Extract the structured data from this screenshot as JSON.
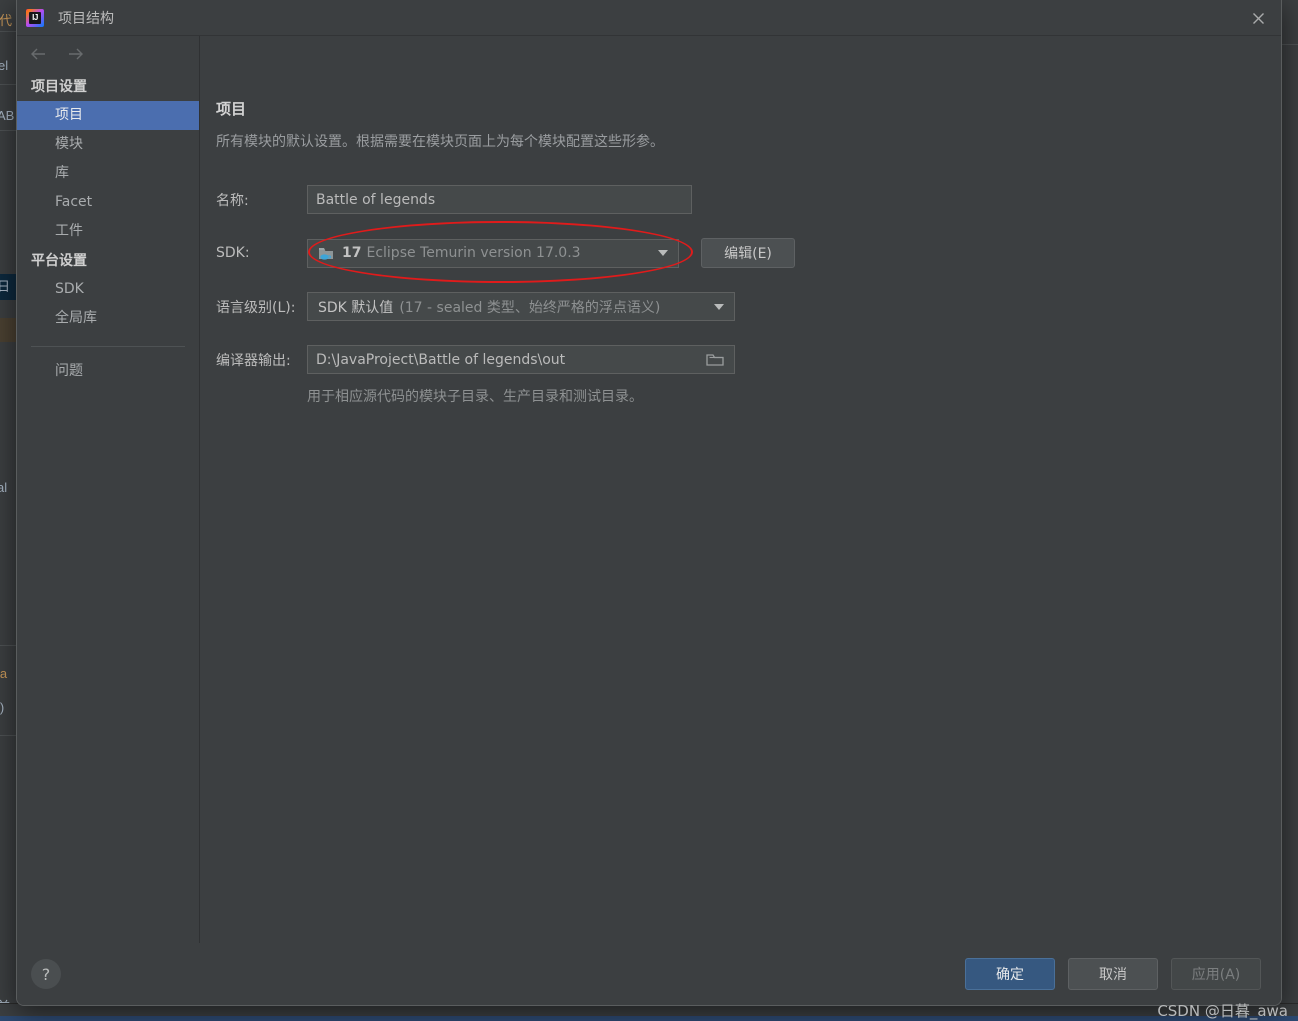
{
  "window": {
    "title": "项目结构",
    "logo_icon": "intellij-idea-logo",
    "close_icon": "close-icon"
  },
  "nav": {
    "back_icon": "arrow-left-icon",
    "forward_icon": "arrow-right-icon"
  },
  "sidebar": {
    "groups": [
      {
        "title": "项目设置",
        "items": [
          {
            "label": "项目",
            "selected": true
          },
          {
            "label": "模块",
            "selected": false
          },
          {
            "label": "库",
            "selected": false
          },
          {
            "label": "Facet",
            "selected": false
          },
          {
            "label": "工件",
            "selected": false
          }
        ]
      },
      {
        "title": "平台设置",
        "items": [
          {
            "label": "SDK",
            "selected": false
          },
          {
            "label": "全局库",
            "selected": false
          }
        ]
      }
    ],
    "problems": {
      "label": "问题"
    }
  },
  "main": {
    "title": "项目",
    "subtitle": "所有模块的默认设置。根据需要在模块页面上为每个模块配置这些形参。",
    "name_row": {
      "label": "名称:",
      "value": "Battle of legends"
    },
    "sdk_row": {
      "label": "SDK:",
      "version_prefix": "17",
      "version_detail": "Eclipse Temurin version 17.0.3",
      "sdk_icon": "java-sdk-folder-icon",
      "dropdown_icon": "chevron-down-icon",
      "edit_button": "编辑(E)",
      "highlight_color": "#e01b1b"
    },
    "language_row": {
      "label": "语言级别(L):",
      "value_main": "SDK 默认值",
      "value_detail": "(17 - sealed 类型、始终严格的浮点语义)",
      "dropdown_icon": "chevron-down-icon"
    },
    "output_row": {
      "label": "编译器输出:",
      "value": "D:\\JavaProject\\Battle of legends\\out",
      "browse_icon": "folder-icon",
      "hint": "用于相应源代码的模块子目录、生产目录和测试目录。"
    }
  },
  "footer": {
    "help_icon": "question-mark-icon",
    "help_label": "?",
    "ok_label": "确定",
    "cancel_label": "取消",
    "apply_label": "应用(A)"
  },
  "watermark": {
    "text": "CSDN @日暮_awa"
  },
  "colors": {
    "dialog_bg": "#3c3f41",
    "selection_blue": "#4b6eaf",
    "primary_button": "#365880",
    "annotation_red": "#e01b1b",
    "field_bg": "#45494a"
  }
}
